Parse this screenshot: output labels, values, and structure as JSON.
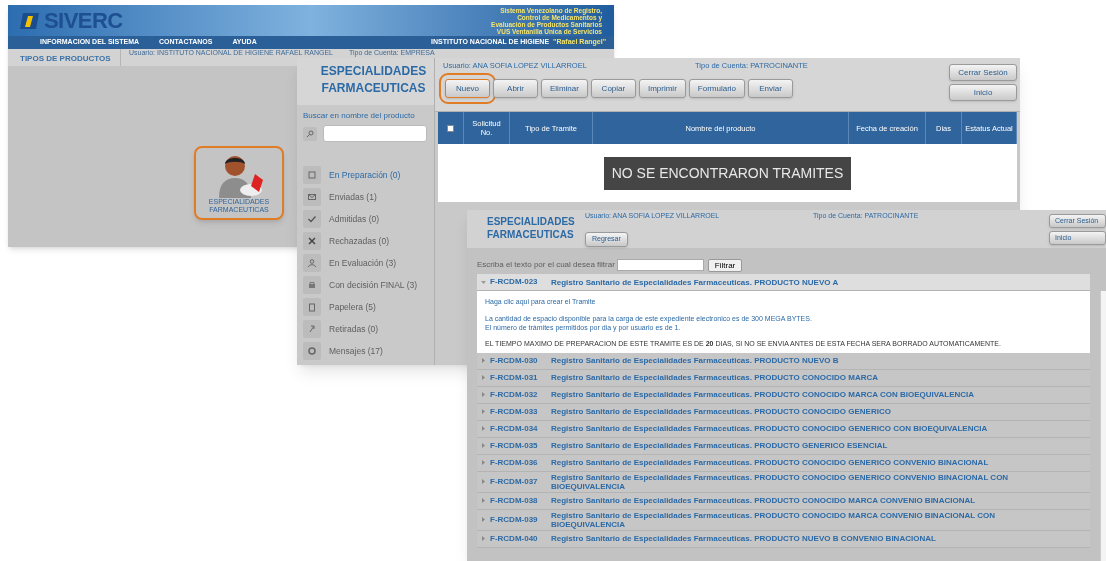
{
  "home_window": {
    "logo": "SIVERC",
    "tagline": [
      "Sistema Venezolano de Registro,",
      "Control de Medicamentos y",
      "Evaluación de Productos Sanitarios",
      "VUS Ventanilla Unica de Servicios"
    ],
    "nav": [
      "INFORMACION DEL SISTEMA",
      "CONTACTANOS",
      "AYUDA"
    ],
    "institute": "INSTITUTO NACIONAL DE HIGIENE",
    "institute_name": "\"Rafael Rangel\"",
    "section_title": "TIPOS DE PRODUCTOS",
    "user": "Usuario: INSTITUTO NACIONAL DE HIGIENE RAFAEL RANGEL",
    "account": "Tipo de Cuenta: EMPRESA",
    "products": [
      {
        "label": "ESPECIALIDADES FARMACEUTICAS",
        "highlighted": true
      }
    ]
  },
  "list_window": {
    "title": "ESPECIALIDADES FARMACEUTICAS",
    "user": "Usuario: ANA SOFIA LOPEZ VILLARROEL",
    "account": "Tipo de Cuenta: PATROCINANTE",
    "toolbar": [
      {
        "label": "Nuevo",
        "highlighted": true
      },
      {
        "label": "Abrir",
        "highlighted": false
      },
      {
        "label": "Eliminar",
        "highlighted": false
      },
      {
        "label": "Copiar",
        "highlighted": false
      },
      {
        "label": "Imprimir",
        "highlighted": false
      },
      {
        "label": "Formulario",
        "highlighted": false
      },
      {
        "label": "Enviar",
        "highlighted": false
      }
    ],
    "session_buttons": [
      "Cerrar Sesión",
      "Inicio"
    ],
    "search_label": "Buscar en nombre del producto",
    "folders": [
      {
        "label": "En Preparación (0)",
        "selected": true
      },
      {
        "label": "Enviadas (1)",
        "selected": false
      },
      {
        "label": "Admitidas (0)",
        "selected": false
      },
      {
        "label": "Rechazadas (0)",
        "selected": false
      },
      {
        "label": "En Evaluación (3)",
        "selected": false
      },
      {
        "label": "Con decisión FINAL (3)",
        "selected": false
      },
      {
        "label": "Papelera (5)",
        "selected": false
      },
      {
        "label": "Retiradas (0)",
        "selected": false
      },
      {
        "label": "Mensajes (17)",
        "selected": false
      }
    ],
    "table": {
      "select_all_checked": false,
      "columns": [
        "Solicitud No.",
        "Tipo de Tramite",
        "Nombre del producto",
        "Fecha de creación",
        "Dias",
        "Estatus Actual"
      ],
      "empty_message": "NO SE ENCONTRARON TRAMITES"
    }
  },
  "tramite_window": {
    "title": "ESPECIALIDADES FARMACEUTICAS",
    "user": "Usuario: ANA SOFIA LOPEZ VILLARROEL",
    "account": "Tipo de Cuenta: PATROCINANTE",
    "back_button": "Regresar",
    "session_buttons": [
      "Cerrar Sesión",
      "Inicio"
    ],
    "filter_label": "Escriba el texto por el cual desea filtrar",
    "filter_button": "Filtrar",
    "tramites": [
      {
        "code": "F-RCDM-023",
        "name": "Registro Sanitario de Especialidades Farmaceuticas. PRODUCTO NUEVO A",
        "expanded": true,
        "create_link": "Haga clic aqui para crear el Tramite",
        "info": [
          "La cantidad de espacio disponible para la carga de este expediente electronico es de 300 MEGA BYTES.",
          "El número de trámites permitidos por dia y por usuario es de 1."
        ],
        "warning": "EL TIEMPO MAXIMO DE PREPARACION DE ESTE TRAMITE ES DE **20** DIAS, SI NO SE ENVIA ANTES DE ESTA FECHA SERA BORRADO AUTOMATICAMENTE."
      },
      {
        "code": "F-RCDM-030",
        "name": "Registro Sanitario de Especialidades Farmaceuticas. PRODUCTO NUEVO B",
        "expanded": false
      },
      {
        "code": "F-RCDM-031",
        "name": "Registro Sanitario de Especialidades Farmaceuticas. PRODUCTO CONOCIDO MARCA",
        "expanded": false
      },
      {
        "code": "F-RCDM-032",
        "name": "Registro Sanitario de Especialidades Farmaceuticas. PRODUCTO CONOCIDO MARCA CON BIOEQUIVALENCIA",
        "expanded": false
      },
      {
        "code": "F-RCDM-033",
        "name": "Registro Sanitario de Especialidades Farmaceuticas. PRODUCTO CONOCIDO GENERICO",
        "expanded": false
      },
      {
        "code": "F-RCDM-034",
        "name": "Registro Sanitario de Especialidades Farmaceuticas. PRODUCTO CONOCIDO GENERICO CON BIOEQUIVALENCIA",
        "expanded": false
      },
      {
        "code": "F-RCDM-035",
        "name": "Registro Sanitario de Especialidades Farmaceuticas. PRODUCTO GENERICO ESENCIAL",
        "expanded": false
      },
      {
        "code": "F-RCDM-036",
        "name": "Registro Sanitario de Especialidades Farmaceuticas. PRODUCTO CONOCIDO GENERICO CONVENIO BINACIONAL",
        "expanded": false
      },
      {
        "code": "F-RCDM-037",
        "name": "Registro Sanitario de Especialidades Farmaceuticas. PRODUCTO CONOCIDO GENERICO CONVENIO BINACIONAL CON BIOEQUIVALENCIA",
        "expanded": false
      },
      {
        "code": "F-RCDM-038",
        "name": "Registro Sanitario de Especialidades Farmaceuticas. PRODUCTO CONOCIDO MARCA CONVENIO BINACIONAL",
        "expanded": false
      },
      {
        "code": "F-RCDM-039",
        "name": "Registro Sanitario de Especialidades Farmaceuticas. PRODUCTO CONOCIDO MARCA CONVENIO BINACIONAL CON BIOEQUIVALENCIA",
        "expanded": false
      },
      {
        "code": "F-RCDM-040",
        "name": "Registro Sanitario de Especialidades Farmaceuticas. PRODUCTO NUEVO B CONVENIO BINACIONAL",
        "expanded": false
      }
    ]
  }
}
